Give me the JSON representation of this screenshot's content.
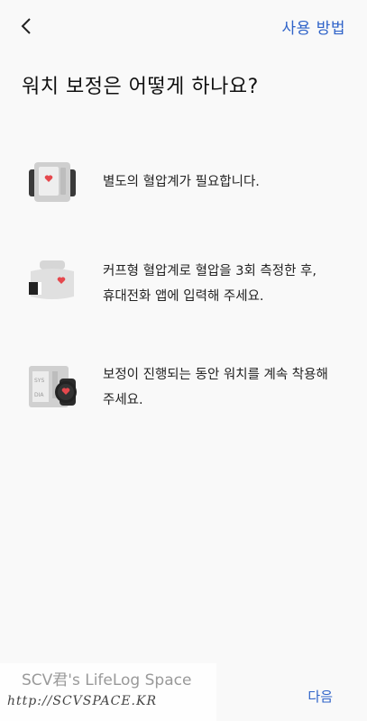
{
  "header": {
    "help_label": "사용 방법"
  },
  "title": "워치 보정은 어떻게 하나요?",
  "steps": [
    {
      "icon": "blood-pressure-monitor-icon",
      "text": "별도의 혈압계가 필요합니다."
    },
    {
      "icon": "cuff-monitor-icon",
      "text_line1": "커프형 혈압계로 혈압을 3회 측정한 후,",
      "text_line2": "휴대전화 앱에 입력해 주세요."
    },
    {
      "icon": "watch-on-monitor-icon",
      "text_line1": "보정이 진행되는 동안 워치를 계속 착용해",
      "text_line2": "주세요."
    }
  ],
  "icon_labels": {
    "sys": "SYS",
    "dia": "DIA"
  },
  "watermark": {
    "title": "SCV君's LifeLog Space",
    "url": "http://SCVSPACE.KR"
  },
  "footer": {
    "next_label": "다음"
  },
  "colors": {
    "accent": "#2f63c9",
    "heart": "#e5484d",
    "background": "#f9f9f9"
  }
}
